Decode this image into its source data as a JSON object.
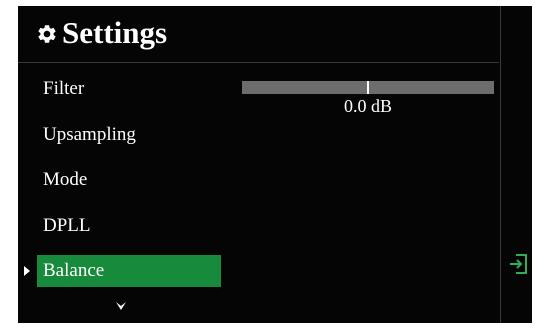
{
  "header": {
    "title": "Settings",
    "icon": "gear-icon"
  },
  "menu": {
    "items": [
      {
        "label": "Filter",
        "selected": false
      },
      {
        "label": "Upsampling",
        "selected": false
      },
      {
        "label": "Mode",
        "selected": false
      },
      {
        "label": "DPLL",
        "selected": false
      },
      {
        "label": "Balance",
        "selected": true
      }
    ],
    "more_indicator": "chevron-down-icon"
  },
  "balance": {
    "value_label": "0.0 dB",
    "value_db": 0.0,
    "position_fraction": 0.5
  },
  "side": {
    "icon": "exit-icon"
  },
  "colors": {
    "background": "#050505",
    "accent": "#178a3c",
    "track": "#6d6d6d",
    "text": "#ffffff"
  }
}
